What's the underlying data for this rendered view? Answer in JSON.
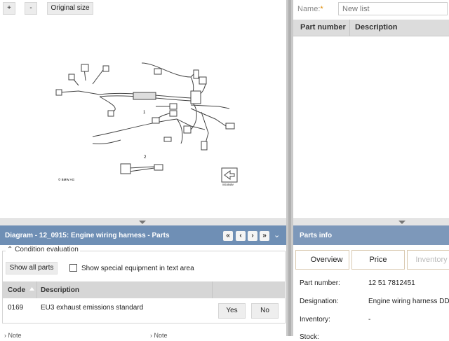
{
  "diagram_toolbar": {
    "zoom_in": "+",
    "zoom_out": "-",
    "original_size": "Original size"
  },
  "diagram": {
    "callout_1": "1",
    "callout_2": "2",
    "copyright": "© BMW AG",
    "ref_code": "0016548V"
  },
  "parts_list": {
    "name_label": "Name:",
    "required_mark": "*",
    "name_placeholder": "New list",
    "columns": [
      "Part number",
      "Description"
    ]
  },
  "diagram_panel": {
    "title": "Diagram - 12_0915: Engine wiring harness - Parts",
    "nav": {
      "first": "«",
      "prev": "‹",
      "next": "›",
      "last": "»",
      "collapse": "⌄"
    },
    "condition_legend": "Condition evaluation",
    "show_all_label": "Show all parts",
    "special_equipment_label": "Show special equipment in text area",
    "table": {
      "columns": [
        "Code",
        "Description"
      ],
      "rows": [
        {
          "code": "0169",
          "description": "EU3 exhaust emissions standard",
          "yes": "Yes",
          "no": "No"
        }
      ]
    },
    "notes": [
      "Note",
      "Note"
    ]
  },
  "parts_info": {
    "title": "Parts info",
    "tabs": [
      "Overview",
      "Price",
      "Inventory"
    ],
    "rows": [
      {
        "label": "Part number:",
        "value": "12 51 7812451"
      },
      {
        "label": "Designation:",
        "value": "Engine wiring harness DD"
      },
      {
        "label": "Inventory:",
        "value": "-"
      },
      {
        "label": "Stock:",
        "value": ""
      }
    ]
  },
  "colors": {
    "panel_header": "#6f8fb5",
    "required": "#e08a00",
    "tab_border": "#d9c9b0"
  }
}
